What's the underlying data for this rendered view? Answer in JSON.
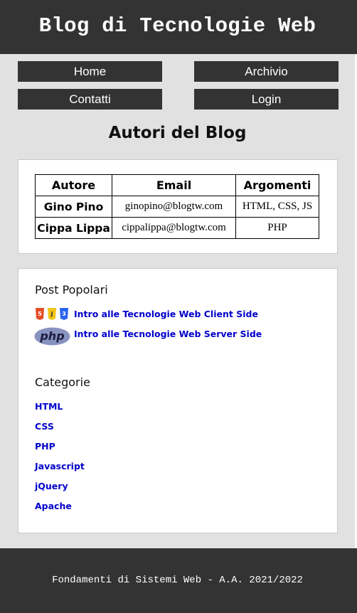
{
  "header": {
    "title": "Blog di Tecnologie Web"
  },
  "nav": {
    "home": "Home",
    "archivio": "Archivio",
    "contatti": "Contatti",
    "login": "Login"
  },
  "main": {
    "title": "Autori del Blog",
    "authors_table": {
      "headers": [
        "Autore",
        "Email",
        "Argomenti"
      ],
      "rows": [
        [
          "Gino Pino",
          "ginopino@blogtw.com",
          "HTML, CSS, JS"
        ],
        [
          "Cippa Lippa",
          "cippalippa@blogtw.com",
          "PHP"
        ]
      ]
    }
  },
  "sidebar": {
    "popular_title": "Post Popolari",
    "popular_posts": [
      {
        "icon": "html5-css3-js-icon",
        "label": "Intro alle Tecnologie Web Client Side"
      },
      {
        "icon": "php-logo-icon",
        "label": "Intro alle Tecnologie Web Server Side"
      }
    ],
    "categories_title": "Categorie",
    "categories": [
      "HTML",
      "CSS",
      "PHP",
      "Javascript",
      "jQuery",
      "Apache"
    ]
  },
  "footer": {
    "text": "Fondamenti di Sistemi Web - A.A. 2021/2022"
  },
  "colors": {
    "dark": "#333333",
    "background": "#e1e1e1",
    "link": "#0000cc",
    "panel": "#ffffff"
  }
}
